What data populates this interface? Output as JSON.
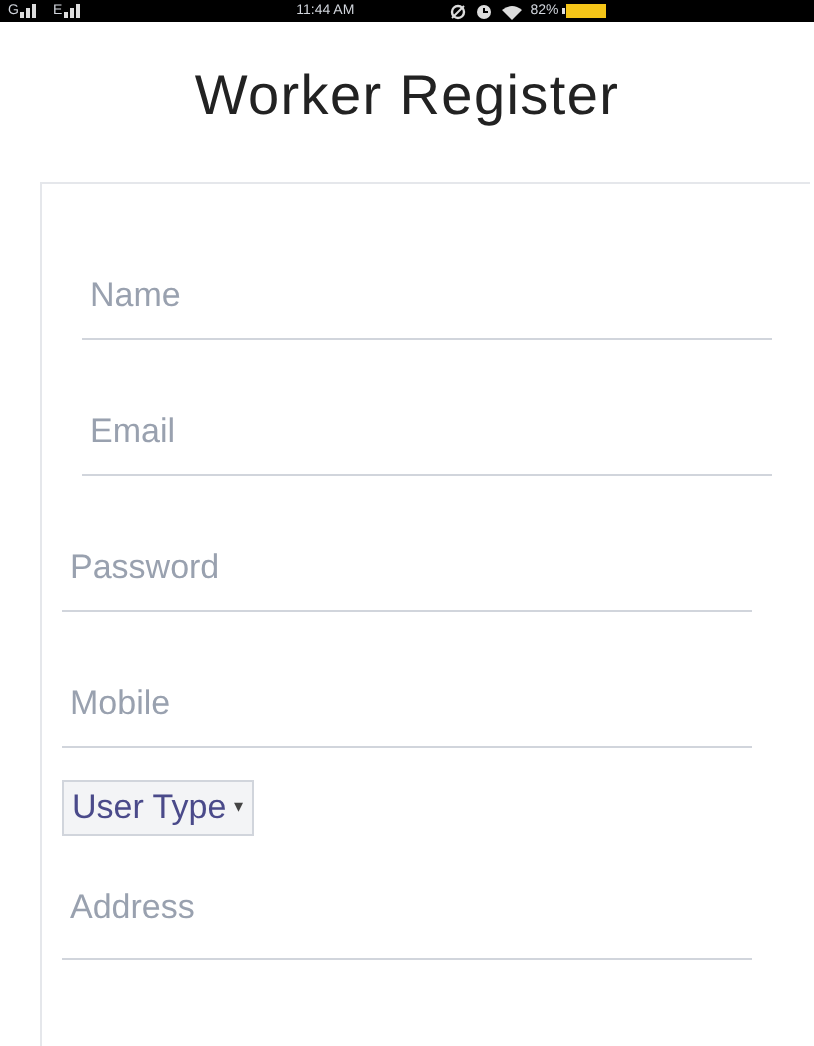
{
  "status_bar": {
    "network_1": "G",
    "network_2": "E",
    "time": "11:44 AM",
    "battery": "82%"
  },
  "title": "Worker Register",
  "fields": [
    {
      "placeholder": "Name"
    },
    {
      "placeholder": "Email"
    },
    {
      "placeholder": "Password"
    },
    {
      "placeholder": "Mobile"
    }
  ],
  "user_type": {
    "label": "User Type",
    "arrow": "▾"
  },
  "address": {
    "placeholder": "Address"
  }
}
